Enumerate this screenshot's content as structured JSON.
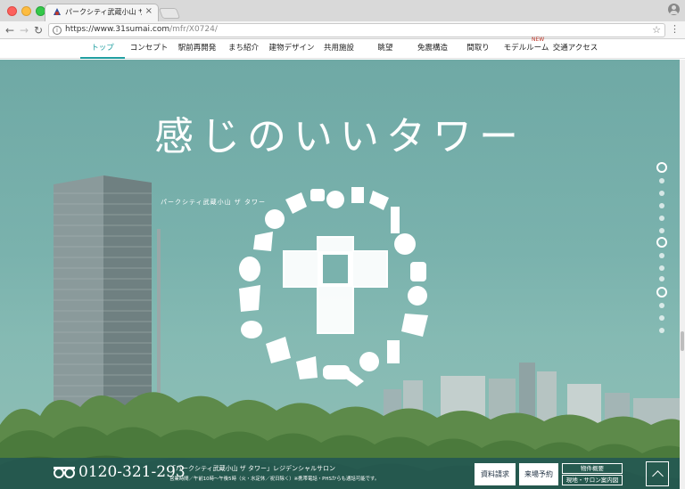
{
  "browser": {
    "tab_title": "パークシティ武蔵小山 ザ タワー",
    "tab_close": "×",
    "url_host": "https://www.31sumai.com",
    "url_path": "/mfr/X0724/"
  },
  "nav": {
    "items": [
      {
        "label": "トップ",
        "active": true
      },
      {
        "label": "コンセプト"
      },
      {
        "label": "駅前再開発"
      },
      {
        "label": "まち紹介"
      },
      {
        "label": "建物デザイン"
      },
      {
        "label": "共用施設"
      },
      {
        "label": "眺望"
      },
      {
        "label": "免震構造"
      },
      {
        "label": "間取り"
      },
      {
        "label": "モデルルーム"
      },
      {
        "label": "交通アクセス"
      }
    ],
    "new_badge": "NEW"
  },
  "hero": {
    "headline": "感じのいいタワー",
    "tower_name": "パークシティ武蔵小山 ザ タワー"
  },
  "pager": {
    "count": 14,
    "rings": [
      0,
      6,
      10
    ]
  },
  "footer": {
    "phone": "0120-321-293",
    "salon": "「パークシティ武蔵小山 ザ タワー」レジデンシャルサロン",
    "hours": "営業時間／午前10時〜午後5時（火・水定休／祝日除く）※携帯電話・PHSからも通話可能です。",
    "request_label": "資料請求",
    "visit_label": "来場予約",
    "summary_label": "物件概要",
    "map_label": "現地・サロン案内図"
  },
  "colors": {
    "accent": "#1f9ea0",
    "hero_bg": "#74aea9",
    "footer_bg": "#205454"
  },
  "icons": {
    "back": "←",
    "forward": "→",
    "reload": "↻",
    "info": "i",
    "star": "☆",
    "menu": "⋮"
  }
}
